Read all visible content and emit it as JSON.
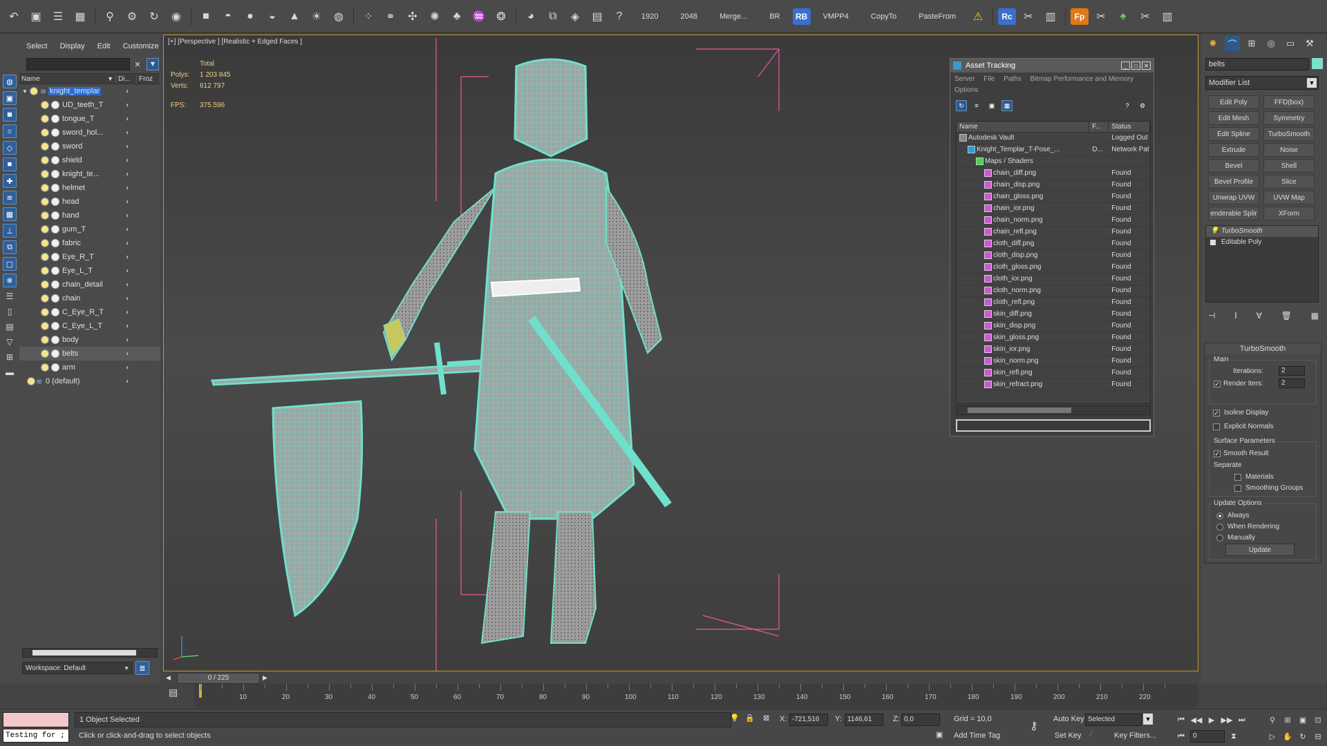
{
  "toolbar": {
    "items": [
      "1920",
      "2048",
      "Merge...",
      "BR",
      "VMPP4",
      "CopyTo",
      "PasteFrom"
    ],
    "badges": {
      "rb": "RB",
      "rc": "Rc",
      "fp": "Fp"
    }
  },
  "explorer": {
    "menu": [
      "Select",
      "Display",
      "Edit",
      "Customize"
    ],
    "headers": {
      "name": "Name",
      "display": "Di...",
      "frozen": "Froz"
    },
    "rows": [
      {
        "name": "knight_templar",
        "level": 0
      },
      {
        "name": "UD_teeth_T",
        "level": 1
      },
      {
        "name": "tongue_T",
        "level": 1
      },
      {
        "name": "sword_hol...",
        "level": 1
      },
      {
        "name": "sword",
        "level": 1
      },
      {
        "name": "shield",
        "level": 1
      },
      {
        "name": "knight_te...",
        "level": 1
      },
      {
        "name": "helmet",
        "level": 1
      },
      {
        "name": "head",
        "level": 1
      },
      {
        "name": "hand",
        "level": 1
      },
      {
        "name": "gum_T",
        "level": 1
      },
      {
        "name": "fabric",
        "level": 1
      },
      {
        "name": "Eye_R_T",
        "level": 1
      },
      {
        "name": "Eye_L_T",
        "level": 1
      },
      {
        "name": "chain_detail",
        "level": 1
      },
      {
        "name": "chain",
        "level": 1
      },
      {
        "name": "C_Eye_R_T",
        "level": 1
      },
      {
        "name": "C_Eye_L_T",
        "level": 1
      },
      {
        "name": "body",
        "level": 1
      },
      {
        "name": "belts",
        "level": 1
      },
      {
        "name": "arm",
        "level": 1
      },
      {
        "name": "0 (default)",
        "level": 0
      }
    ],
    "workspace": "Workspace: Default"
  },
  "viewport": {
    "label": "[+] [Perspective ] [Realistic + Edged Faces ]",
    "stats": {
      "total_label": "Total",
      "polys_label": "Polys:",
      "polys": "1 203 845",
      "verts_label": "Verts:",
      "verts": "612 797",
      "fps_label": "FPS:",
      "fps": "375.596"
    }
  },
  "asset_tracking": {
    "title": "Asset Tracking",
    "menu": [
      "Server",
      "File",
      "Paths",
      "Bitmap Performance and Memory",
      "Options"
    ],
    "columns": [
      "Name",
      "F...",
      "Status"
    ],
    "rows": [
      {
        "name": "Autodesk Vault",
        "f": "",
        "status": "Logged Out",
        "indent": 0
      },
      {
        "name": "Knight_Templar_T-Pose_...",
        "f": "D...",
        "status": "Network Pat",
        "indent": 1
      },
      {
        "name": "Maps / Shaders",
        "f": "",
        "status": "",
        "indent": 2
      },
      {
        "name": "chain_diff.png",
        "f": "",
        "status": "Found",
        "indent": 3
      },
      {
        "name": "chain_disp.png",
        "f": "",
        "status": "Found",
        "indent": 3
      },
      {
        "name": "chain_gloss.png",
        "f": "",
        "status": "Found",
        "indent": 3
      },
      {
        "name": "chain_ior.png",
        "f": "",
        "status": "Found",
        "indent": 3
      },
      {
        "name": "chain_norm.png",
        "f": "",
        "status": "Found",
        "indent": 3
      },
      {
        "name": "chain_refl.png",
        "f": "",
        "status": "Found",
        "indent": 3
      },
      {
        "name": "cloth_diff.png",
        "f": "",
        "status": "Found",
        "indent": 3
      },
      {
        "name": "cloth_disp.png",
        "f": "",
        "status": "Found",
        "indent": 3
      },
      {
        "name": "cloth_gloss.png",
        "f": "",
        "status": "Found",
        "indent": 3
      },
      {
        "name": "cloth_ior.png",
        "f": "",
        "status": "Found",
        "indent": 3
      },
      {
        "name": "cloth_norm.png",
        "f": "",
        "status": "Found",
        "indent": 3
      },
      {
        "name": "cloth_refl.png",
        "f": "",
        "status": "Found",
        "indent": 3
      },
      {
        "name": "skin_diff.png",
        "f": "",
        "status": "Found",
        "indent": 3
      },
      {
        "name": "skin_disp.png",
        "f": "",
        "status": "Found",
        "indent": 3
      },
      {
        "name": "skin_gloss.png",
        "f": "",
        "status": "Found",
        "indent": 3
      },
      {
        "name": "skin_ior.png",
        "f": "",
        "status": "Found",
        "indent": 3
      },
      {
        "name": "skin_norm.png",
        "f": "",
        "status": "Found",
        "indent": 3
      },
      {
        "name": "skin_refl.png",
        "f": "",
        "status": "Found",
        "indent": 3
      },
      {
        "name": "skin_refract.png",
        "f": "",
        "status": "Found",
        "indent": 3
      }
    ]
  },
  "command_panel": {
    "object_name": "belts",
    "modifier_list": "Modifier List",
    "modifier_buttons": [
      "Edit Poly",
      "FFD(box)",
      "Edit Mesh",
      "Symmetry",
      "Edit Spline",
      "TurboSmooth",
      "Extrude",
      "Noise",
      "Bevel",
      "Shell",
      "Bevel Profile",
      "Slice",
      "Unwrap UVW",
      "UVW Map",
      "enderable Splir",
      "XForm"
    ],
    "stack": [
      "TurboSmooth",
      "Editable Poly"
    ],
    "rollout": {
      "title": "TurboSmooth",
      "main": "Main",
      "iterations_label": "Iterations:",
      "iterations": "2",
      "render_iters_label": "Render Iters:",
      "render_iters": "2",
      "isoline": "Isoline Display",
      "explicit_normals": "Explicit Normals",
      "surface_params": "Surface Parameters",
      "smooth_result": "Smooth Result",
      "separate": "Separate",
      "materials": "Materials",
      "smoothing_groups": "Smoothing Groups",
      "update_options": "Update Options",
      "always": "Always",
      "when_rendering": "When Rendering",
      "manually": "Manually",
      "update": "Update"
    }
  },
  "timeline": {
    "frame": "0 / 225",
    "ticks": [
      "10",
      "20",
      "30",
      "40",
      "50",
      "60",
      "70",
      "80",
      "90",
      "100",
      "110",
      "120",
      "130",
      "140",
      "150",
      "160",
      "170",
      "180",
      "190",
      "200",
      "210",
      "220"
    ]
  },
  "statusbar": {
    "maxscript": "Testing for ;",
    "selection": "1 Object Selected",
    "prompt": "Click or click-and-drag to select objects",
    "x_label": "X:",
    "x": "-721,516",
    "y_label": "Y:",
    "y": "1146,61",
    "z_label": "Z:",
    "z": "0,0",
    "grid": "Grid = 10,0",
    "add_time_tag": "Add Time Tag",
    "auto_key": "Auto Key",
    "set_key": "Set Key",
    "selected": "Selected",
    "key_filters": "Key Filters...",
    "frame_value": "0"
  }
}
